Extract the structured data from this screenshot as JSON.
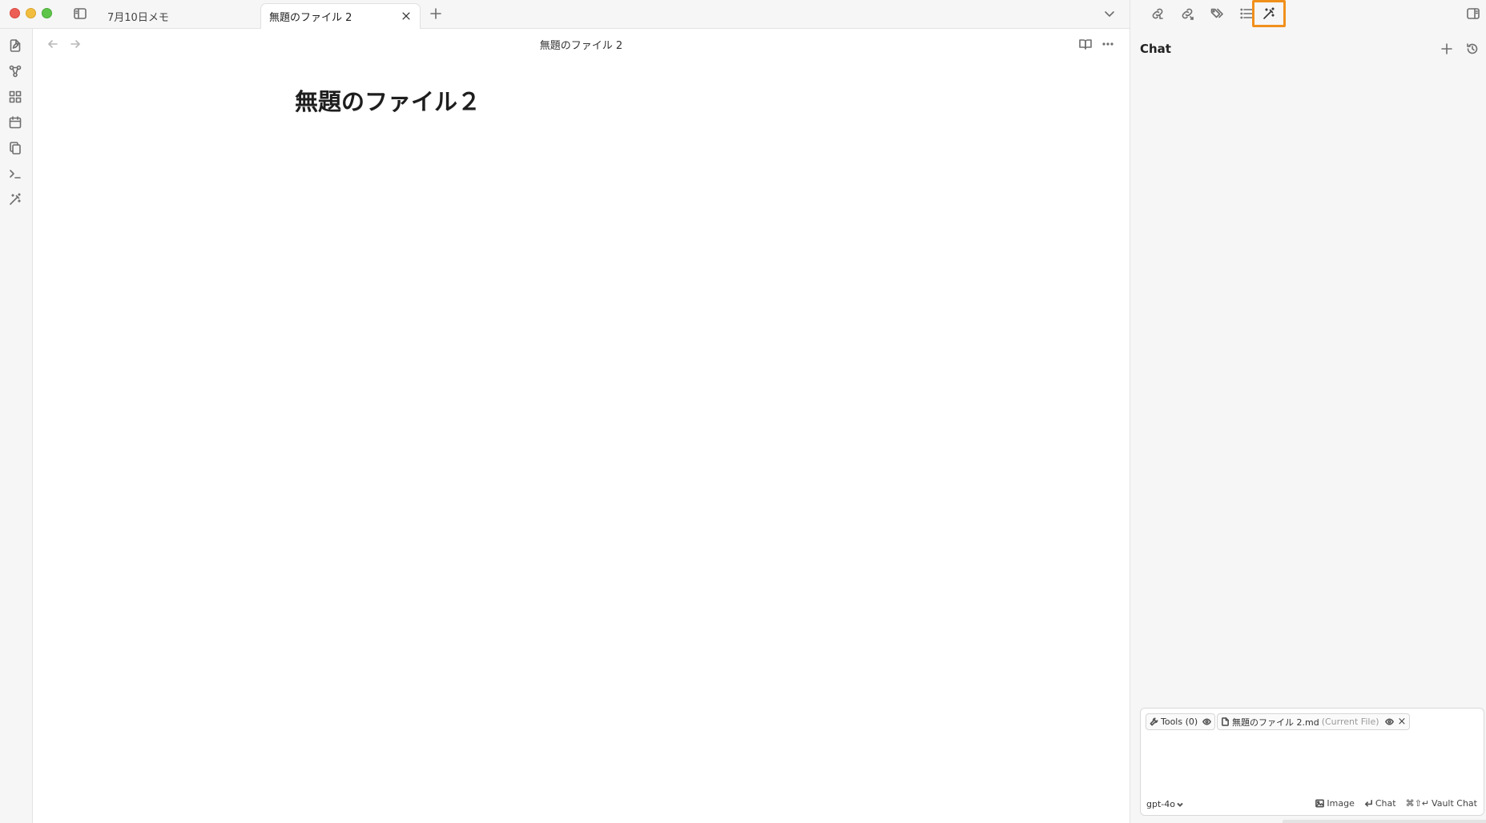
{
  "tabs": [
    {
      "label": "7月10日メモ",
      "active": false
    },
    {
      "label": "無題のファイル 2",
      "active": true
    }
  ],
  "editor": {
    "header_title": "無題のファイル 2",
    "document_title": "無題のファイル２"
  },
  "ribbon": {
    "icons": [
      "new-note-icon",
      "graph-view-icon",
      "plugins-icon",
      "calendar-icon",
      "copy-icon",
      "terminal-icon",
      "magic-wand-icon"
    ]
  },
  "right_toolbar": {
    "icons": [
      "backlinks-icon",
      "outgoing-links-icon",
      "tags-icon",
      "outline-icon",
      "magic-wand-icon"
    ],
    "highlighted": "magic-wand-icon"
  },
  "chat": {
    "title": "Chat",
    "tools_chip": "Tools (0)",
    "file_chip_name": "無題のファイル 2.md",
    "file_chip_note": "(Current File)",
    "model": "gpt-4o",
    "action_image": "Image",
    "action_chat": "Chat",
    "action_vault_shortcut": "⌘⇧↵",
    "action_vault": "Vault Chat"
  },
  "colors": {
    "highlight": "#f0901c",
    "traffic_red": "#ec5f57",
    "traffic_yellow": "#f2be40",
    "traffic_green": "#5ec54a"
  }
}
